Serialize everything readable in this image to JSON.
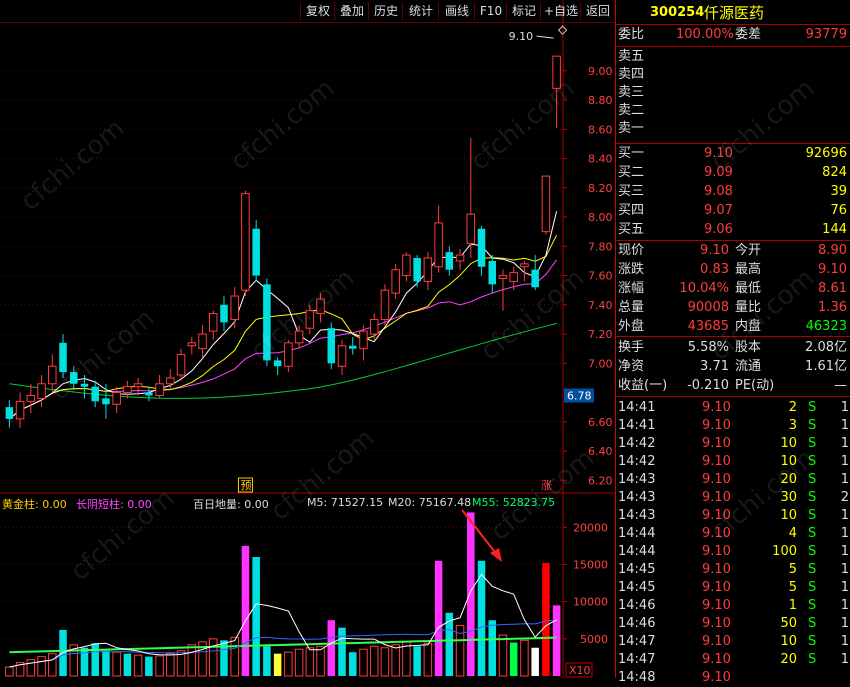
{
  "toolbar": {
    "buttons": [
      "复权",
      "叠加",
      "历史",
      "统计",
      "画线",
      "F10",
      "标记",
      "+自选",
      "返回"
    ]
  },
  "stock": {
    "code": "300254",
    "name": "仟源医药"
  },
  "order_book": {
    "weibi_label": "委比",
    "weibi": "100.00%",
    "weicha_label": "委差",
    "weicha": "93779",
    "asks": [
      {
        "label": "卖五",
        "price": "",
        "vol": ""
      },
      {
        "label": "卖四",
        "price": "",
        "vol": ""
      },
      {
        "label": "卖三",
        "price": "",
        "vol": ""
      },
      {
        "label": "卖二",
        "price": "",
        "vol": ""
      },
      {
        "label": "卖一",
        "price": "",
        "vol": ""
      }
    ],
    "bids": [
      {
        "label": "买一",
        "price": "9.10",
        "vol": "92696"
      },
      {
        "label": "买二",
        "price": "9.09",
        "vol": "824"
      },
      {
        "label": "买三",
        "price": "9.08",
        "vol": "39"
      },
      {
        "label": "买四",
        "price": "9.07",
        "vol": "76"
      },
      {
        "label": "买五",
        "price": "9.06",
        "vol": "144"
      }
    ]
  },
  "quote": {
    "rows": [
      {
        "l1": "现价",
        "v1": "9.10",
        "l2": "今开",
        "v2": "8.90"
      },
      {
        "l1": "涨跌",
        "v1": "0.83",
        "l2": "最高",
        "v2": "9.10"
      },
      {
        "l1": "涨幅",
        "v1": "10.04%",
        "l2": "最低",
        "v2": "8.61"
      },
      {
        "l1": "总量",
        "v1": "90008",
        "l2": "量比",
        "v2": "1.36"
      },
      {
        "l1": "外盘",
        "v1": "43685",
        "l2": "内盘",
        "v2": "46323"
      }
    ],
    "rows2": [
      {
        "l1": "换手",
        "v1": "5.58%",
        "l2": "股本",
        "v2": "2.08亿"
      },
      {
        "l1": "净资",
        "v1": "3.71",
        "l2": "流通",
        "v2": "1.61亿"
      },
      {
        "l1": "收益(一)",
        "v1": "-0.210",
        "l2": "PE(动)",
        "v2": "—"
      }
    ]
  },
  "ticks": [
    {
      "t": "14:41",
      "p": "9.10",
      "v": "2",
      "s": "S",
      "n": "1"
    },
    {
      "t": "14:41",
      "p": "9.10",
      "v": "3",
      "s": "S",
      "n": "1"
    },
    {
      "t": "14:42",
      "p": "9.10",
      "v": "10",
      "s": "S",
      "n": "1"
    },
    {
      "t": "14:42",
      "p": "9.10",
      "v": "10",
      "s": "S",
      "n": "1"
    },
    {
      "t": "14:43",
      "p": "9.10",
      "v": "20",
      "s": "S",
      "n": "1"
    },
    {
      "t": "14:43",
      "p": "9.10",
      "v": "30",
      "s": "S",
      "n": "2"
    },
    {
      "t": "14:43",
      "p": "9.10",
      "v": "10",
      "s": "S",
      "n": "1"
    },
    {
      "t": "14:44",
      "p": "9.10",
      "v": "4",
      "s": "S",
      "n": "1"
    },
    {
      "t": "14:44",
      "p": "9.10",
      "v": "100",
      "s": "S",
      "n": "1"
    },
    {
      "t": "14:45",
      "p": "9.10",
      "v": "5",
      "s": "S",
      "n": "1"
    },
    {
      "t": "14:45",
      "p": "9.10",
      "v": "5",
      "s": "S",
      "n": "1"
    },
    {
      "t": "14:46",
      "p": "9.10",
      "v": "1",
      "s": "S",
      "n": "1"
    },
    {
      "t": "14:46",
      "p": "9.10",
      "v": "50",
      "s": "S",
      "n": "1"
    },
    {
      "t": "14:47",
      "p": "9.10",
      "v": "10",
      "s": "S",
      "n": "1"
    },
    {
      "t": "14:47",
      "p": "9.10",
      "v": "20",
      "s": "S",
      "n": "1"
    },
    {
      "t": "14:48",
      "p": "9.10",
      "v": "",
      "s": "",
      "n": ""
    }
  ],
  "chart_data": {
    "type": "candlestick",
    "price_axis": {
      "ticks": [
        "9.00",
        "8.80",
        "8.60",
        "8.40",
        "8.20",
        "8.00",
        "7.80",
        "7.60",
        "7.40",
        "7.20",
        "7.00",
        "6.78",
        "6.60",
        "6.40",
        "6.20"
      ],
      "range": [
        6.12,
        9.32
      ],
      "current_marker": "6.78"
    },
    "high_annotation": "9.10",
    "markers": [
      "预",
      "涨"
    ],
    "candles": [
      [
        6.7,
        6.62,
        6.75,
        6.56
      ],
      [
        6.62,
        6.74,
        6.8,
        6.56
      ],
      [
        6.74,
        6.78,
        6.86,
        6.66
      ],
      [
        6.76,
        6.86,
        6.92,
        6.7
      ],
      [
        6.86,
        6.98,
        7.06,
        6.8
      ],
      [
        7.14,
        6.94,
        7.2,
        6.9
      ],
      [
        6.94,
        6.86,
        6.98,
        6.82
      ],
      [
        6.86,
        6.84,
        6.92,
        6.76
      ],
      [
        6.84,
        6.74,
        6.88,
        6.7
      ],
      [
        6.76,
        6.72,
        6.86,
        6.62
      ],
      [
        6.72,
        6.8,
        6.84,
        6.66
      ],
      [
        6.8,
        6.84,
        6.88,
        6.76
      ],
      [
        6.84,
        6.86,
        6.9,
        6.78
      ],
      [
        6.8,
        6.78,
        6.84,
        6.74
      ],
      [
        6.78,
        6.86,
        6.92,
        6.76
      ],
      [
        6.86,
        6.9,
        6.96,
        6.82
      ],
      [
        6.92,
        7.06,
        7.1,
        6.88
      ],
      [
        7.12,
        7.14,
        7.18,
        7.06
      ],
      [
        7.1,
        7.2,
        7.26,
        7.04
      ],
      [
        7.22,
        7.34,
        7.36,
        7.16
      ],
      [
        7.4,
        7.28,
        7.46,
        7.22
      ],
      [
        7.3,
        7.46,
        7.52,
        7.24
      ],
      [
        7.5,
        8.16,
        8.18,
        7.46
      ],
      [
        7.92,
        7.6,
        7.98,
        7.56
      ],
      [
        7.54,
        7.02,
        7.58,
        6.98
      ],
      [
        7.02,
        6.98,
        7.04,
        6.92
      ],
      [
        6.98,
        7.14,
        7.16,
        6.94
      ],
      [
        7.14,
        7.22,
        7.26,
        7.1
      ],
      [
        7.24,
        7.36,
        7.4,
        7.2
      ],
      [
        7.34,
        7.44,
        7.48,
        7.28
      ],
      [
        7.24,
        7.0,
        7.28,
        6.96
      ],
      [
        6.98,
        7.12,
        7.16,
        6.92
      ],
      [
        7.12,
        7.1,
        7.18,
        7.06
      ],
      [
        7.1,
        7.22,
        7.26,
        7.02
      ],
      [
        7.2,
        7.3,
        7.34,
        7.16
      ],
      [
        7.3,
        7.5,
        7.54,
        7.26
      ],
      [
        7.48,
        7.64,
        7.68,
        7.44
      ],
      [
        7.6,
        7.74,
        7.76,
        7.56
      ],
      [
        7.72,
        7.56,
        7.74,
        7.52
      ],
      [
        7.56,
        7.72,
        7.76,
        7.5
      ],
      [
        7.66,
        7.96,
        8.08,
        7.62
      ],
      [
        7.76,
        7.64,
        7.8,
        7.6
      ],
      [
        7.7,
        7.74,
        7.78,
        7.64
      ],
      [
        7.82,
        8.02,
        8.54,
        7.72
      ],
      [
        7.92,
        7.66,
        7.94,
        7.6
      ],
      [
        7.7,
        7.54,
        7.74,
        7.48
      ],
      [
        7.58,
        7.6,
        7.64,
        7.36
      ],
      [
        7.56,
        7.62,
        7.66,
        7.5
      ],
      [
        7.66,
        7.68,
        7.7,
        7.56
      ],
      [
        7.64,
        7.52,
        7.74,
        7.5
      ],
      [
        7.9,
        8.28,
        8.28,
        7.88
      ],
      [
        8.88,
        9.1,
        9.1,
        8.61
      ]
    ],
    "ma_lines": [
      {
        "name": "MA5",
        "color": "#ffffff"
      },
      {
        "name": "MA10",
        "color": "#ffff00"
      },
      {
        "name": "MA20",
        "color": "#ff44ff"
      },
      {
        "name": "MA60",
        "color": "#00cc33"
      }
    ],
    "volume_axis": {
      "ticks": [
        "20000",
        "15000",
        "10000",
        "5000"
      ],
      "range": [
        0,
        23000
      ],
      "unit": "X10"
    },
    "volume_indicators": {
      "huangjin": "黄金柱: 0.00",
      "changyin": "长阴短柱: 0.00",
      "bairi": "百日地量: 0.00",
      "m5": "M5: 71527.15",
      "m20": "M20: 75167.48",
      "m55": "M55: 52823.75"
    },
    "volumes": [
      [
        1200,
        "r"
      ],
      [
        1800,
        "r"
      ],
      [
        2200,
        "r"
      ],
      [
        2600,
        "r"
      ],
      [
        3000,
        "r"
      ],
      [
        6200,
        "c"
      ],
      [
        4200,
        "r"
      ],
      [
        3800,
        "c"
      ],
      [
        4400,
        "c"
      ],
      [
        3400,
        "c"
      ],
      [
        3200,
        "r"
      ],
      [
        3000,
        "c"
      ],
      [
        2800,
        "r"
      ],
      [
        2600,
        "c"
      ],
      [
        2700,
        "r"
      ],
      [
        3000,
        "r"
      ],
      [
        3400,
        "r"
      ],
      [
        4200,
        "r"
      ],
      [
        4600,
        "r"
      ],
      [
        5000,
        "r"
      ],
      [
        4800,
        "c"
      ],
      [
        5200,
        "r"
      ],
      [
        17500,
        "m"
      ],
      [
        16000,
        "c"
      ],
      [
        4000,
        "c"
      ],
      [
        3000,
        "y"
      ],
      [
        3200,
        "r"
      ],
      [
        3600,
        "r"
      ],
      [
        3800,
        "r"
      ],
      [
        4000,
        "r"
      ],
      [
        7500,
        "m"
      ],
      [
        6500,
        "c"
      ],
      [
        3200,
        "c"
      ],
      [
        3600,
        "r"
      ],
      [
        4000,
        "r"
      ],
      [
        3800,
        "r"
      ],
      [
        4200,
        "r"
      ],
      [
        4600,
        "r"
      ],
      [
        4000,
        "c"
      ],
      [
        4400,
        "r"
      ],
      [
        15500,
        "m"
      ],
      [
        8500,
        "c"
      ],
      [
        6800,
        "r"
      ],
      [
        22000,
        "m"
      ],
      [
        15500,
        "c"
      ],
      [
        7500,
        "c"
      ],
      [
        5500,
        "r"
      ],
      [
        4500,
        "g"
      ],
      [
        4800,
        "r"
      ],
      [
        3800,
        "w"
      ],
      [
        15200,
        "R"
      ],
      [
        9500,
        "m"
      ]
    ]
  },
  "watermark": "cfchi.com",
  "colors": {
    "up": "#ff3c3c",
    "down": "#00e0e0",
    "grid": "#8b0000"
  }
}
